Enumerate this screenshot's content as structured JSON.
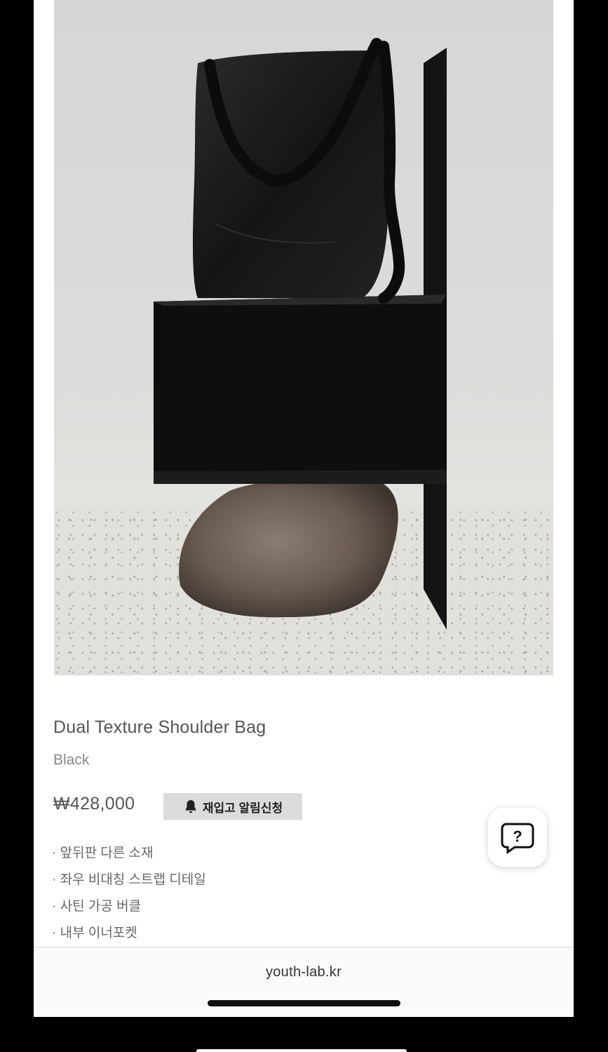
{
  "product": {
    "image_alt": "Black shoulder bag on metal pedestal with rock",
    "name": "Dual Texture Shoulder Bag",
    "color": "Black",
    "price": "₩428,000",
    "restock_button_label": "재입고 알림신청",
    "features": [
      "앞뒤판 다른 소재",
      "좌우 비대칭 스트랩 디테일",
      "사틴 가공 버클",
      "내부 이너포켓"
    ]
  },
  "help_button": {
    "icon": "question-bubble-icon"
  },
  "browser": {
    "url": "youth-lab.kr"
  },
  "colors": {
    "restock_bg": "#dcdcdc",
    "text_primary": "#555555",
    "text_secondary": "#8a8a8a"
  }
}
